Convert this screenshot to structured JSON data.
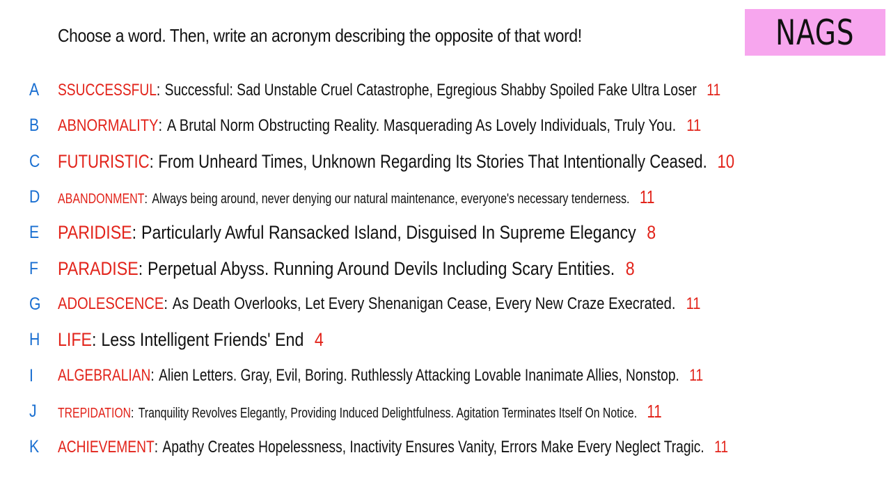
{
  "header": {
    "instruction": "Choose a word. Then, write an acronym describing the opposite of that word!",
    "tag": "NAGS"
  },
  "entries": [
    {
      "letter": "A",
      "word": "SSUCCESSFUL",
      "acronym": "Successful: Sad Unstable Cruel Catastrophe, Egregious Shabby Spoiled Fake Ultra Loser",
      "score": "11"
    },
    {
      "letter": "B",
      "word": "ABNORMALITY",
      "acronym": "A Brutal Norm Obstructing Reality. Masquerading As Lovely Individuals, Truly You.",
      "score": "11"
    },
    {
      "letter": "C",
      "word": "FUTURISTIC",
      "acronym": "From Unheard Times, Unknown Regarding Its Stories That Intentionally Ceased.",
      "score": "10"
    },
    {
      "letter": "D",
      "word": "ABANDONMENT",
      "acronym": "Always being around, never denying our natural maintenance, everyone's necessary tenderness.",
      "score": "11"
    },
    {
      "letter": "E",
      "word": "PARIDISE",
      "acronym": "Particularly Awful Ransacked Island, Disguised In Supreme Elegancy",
      "score": "8"
    },
    {
      "letter": "F",
      "word": "PARADISE",
      "acronym": "Perpetual Abyss. Running Around Devils Including Scary Entities.",
      "score": "8"
    },
    {
      "letter": "G",
      "word": "ADOLESCENCE",
      "acronym": "As Death Overlooks, Let Every Shenanigan Cease, Every New Craze Execrated.",
      "score": "11"
    },
    {
      "letter": "H",
      "word": "LIFE",
      "acronym": "Less Intelligent Friends' End",
      "score": "4"
    },
    {
      "letter": "I",
      "word": "ALGEBRALIAN",
      "acronym": "Alien Letters. Gray, Evil, Boring. Ruthlessly Attacking Lovable Inanimate Allies, Nonstop.",
      "score": "11"
    },
    {
      "letter": "J",
      "word": "TREPIDATION",
      "acronym": "Tranquility Revolves Elegantly, Providing Induced Delightfulness. Agitation Terminates Itself On Notice.",
      "score": "11"
    },
    {
      "letter": "K",
      "word": "ACHIEVEMENT",
      "acronym": "Apathy Creates Hopelessness, Inactivity Ensures Vanity, Errors Make Every Neglect Tragic.",
      "score": "11"
    }
  ],
  "colors": {
    "letter": "#1a6fd1",
    "word": "#e2231a",
    "score": "#e2231a",
    "tag_background": "#f7a6ee",
    "text": "#111111"
  }
}
